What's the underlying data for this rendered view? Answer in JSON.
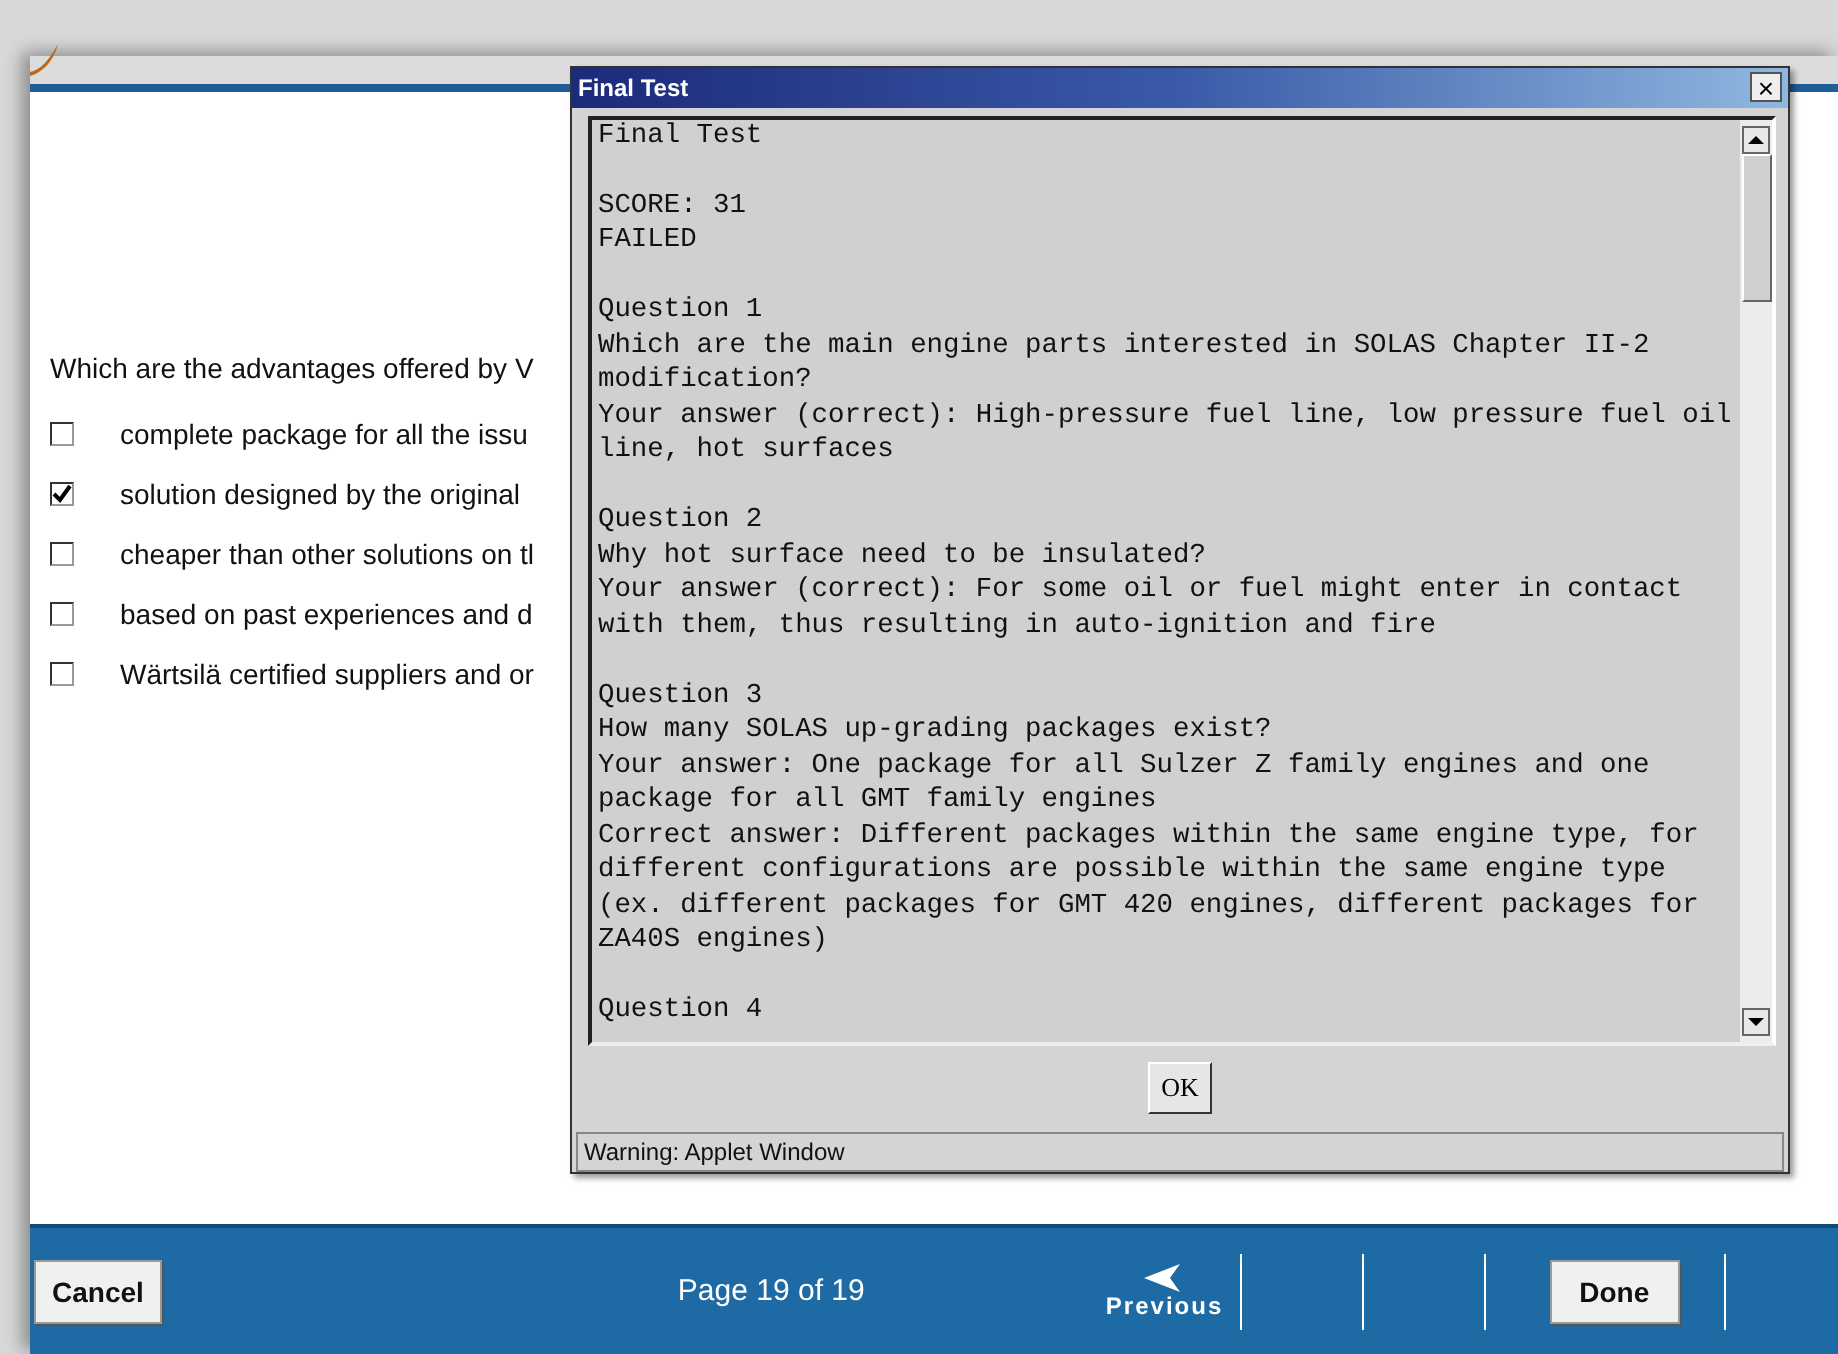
{
  "question": {
    "prompt": "Which are the advantages offered by V",
    "options": [
      {
        "label": "complete package for all the issu",
        "checked": false
      },
      {
        "label": "solution designed by the original",
        "checked": true
      },
      {
        "label": "cheaper than other solutions on tl",
        "checked": false
      },
      {
        "label": "based on past experiences and d",
        "checked": false
      },
      {
        "label": "Wärtsilä certified suppliers and or",
        "checked": false
      }
    ]
  },
  "dialog": {
    "title": "Final Test",
    "close": "×",
    "report": [
      {
        "lines": [
          "Final Test"
        ]
      },
      {
        "lines": [
          "SCORE: 31",
          "FAILED"
        ]
      },
      {
        "lines": [
          "Question 1",
          "Which are the main engine parts interested in SOLAS Chapter II-2",
          "modification?",
          "Your answer (correct): High-pressure fuel line, low pressure fuel oil",
          "line, hot surfaces"
        ]
      },
      {
        "lines": [
          "Question 2",
          "Why hot surface need to be insulated?",
          "Your answer (correct): For some oil or fuel might enter in contact",
          "with them, thus resulting in auto-ignition and fire"
        ]
      },
      {
        "lines": [
          "Question 3",
          "How many SOLAS up-grading packages exist?",
          "Your answer: One package for all Sulzer Z family engines and one",
          "package for all GMT family engines",
          "Correct answer: Different packages within the same engine type, for",
          "different configurations are possible within the same engine type",
          "(ex. different packages for GMT 420 engines, different packages for",
          "ZA40S engines)"
        ]
      },
      {
        "lines": [
          "Question 4"
        ]
      }
    ],
    "ok": "OK",
    "status": "Warning: Applet Window"
  },
  "footer": {
    "cancel": "Cancel",
    "page": "Page 19 of 19",
    "previous": "Previous",
    "done": "Done"
  }
}
